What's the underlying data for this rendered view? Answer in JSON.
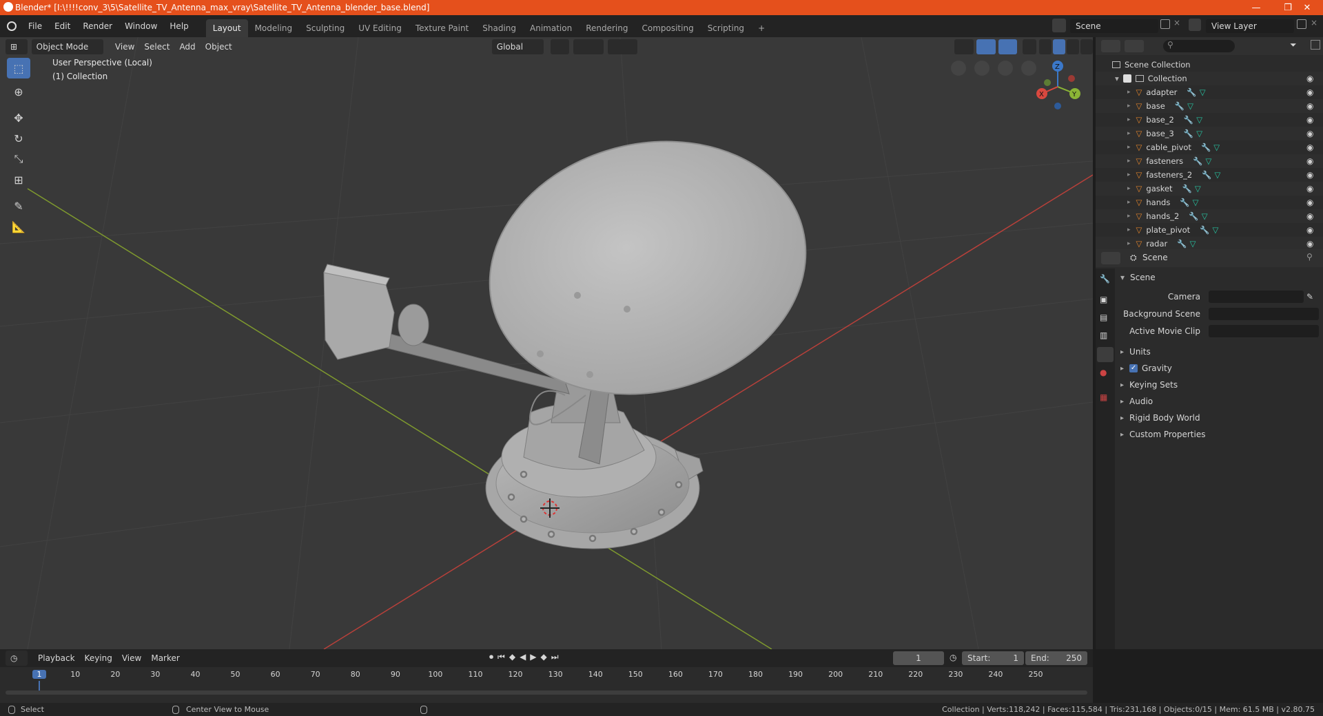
{
  "window": {
    "title": "Blender* [I:\\!!!!conv_3\\5\\Satellite_TV_Antenna_max_vray\\Satellite_TV_Antenna_blender_base.blend]",
    "minimize": "—",
    "maximize": "❐",
    "close": "✕"
  },
  "menu": [
    "File",
    "Edit",
    "Render",
    "Window",
    "Help"
  ],
  "workspaces": [
    "Layout",
    "Modeling",
    "Sculpting",
    "UV Editing",
    "Texture Paint",
    "Shading",
    "Animation",
    "Rendering",
    "Compositing",
    "Scripting"
  ],
  "workspace_add": "+",
  "scene_field": "Scene",
  "view_layer_field": "View Layer",
  "viewport": {
    "mode": "Object Mode",
    "menus": [
      "View",
      "Select",
      "Add",
      "Object"
    ],
    "orientation": "Global",
    "overlay_line1": "User Perspective (Local)",
    "overlay_line2": "(1) Collection",
    "gizmo": {
      "z": "Z",
      "y": "Y",
      "x": "X"
    }
  },
  "outliner": {
    "root": "Scene Collection",
    "collection": "Collection",
    "objects": [
      "adapter",
      "base",
      "base_2",
      "base_3",
      "cable_pivot",
      "fasteners",
      "fasteners_2",
      "gasket",
      "hands",
      "hands_2",
      "plate_pivot",
      "radar"
    ]
  },
  "properties": {
    "header": "Scene",
    "panel": "Scene",
    "fields": [
      {
        "label": "Camera"
      },
      {
        "label": "Background Scene"
      },
      {
        "label": "Active Movie Clip"
      }
    ],
    "subpanels": [
      "Units",
      "Gravity",
      "Keying Sets",
      "Audio",
      "Rigid Body World",
      "Custom Properties"
    ],
    "gravity_checked": true
  },
  "timeline": {
    "menus": [
      "Playback",
      "Keying",
      "View",
      "Marker"
    ],
    "current_frame": "1",
    "start_label": "Start:",
    "start": "1",
    "end_label": "End:",
    "end": "250",
    "ticks": [
      "1",
      "10",
      "20",
      "30",
      "40",
      "50",
      "60",
      "70",
      "80",
      "90",
      "100",
      "110",
      "120",
      "130",
      "140",
      "150",
      "160",
      "170",
      "180",
      "190",
      "200",
      "210",
      "220",
      "230",
      "240",
      "250"
    ]
  },
  "status": {
    "left_action": "Select",
    "middle_action": "Center View to Mouse",
    "stats": "Collection | Verts:118,242 | Faces:115,584 | Tris:231,168 | Objects:0/15 | Mem: 61.5 MB | v2.80.75"
  },
  "colors": {
    "titlebar": "#e5501c",
    "accent": "#4772b3",
    "x_axis": "#d9483f",
    "y_axis": "#8bb536",
    "z_axis": "#3b78c9",
    "object_icon": "#e0832b",
    "mesh_icon": "#27c4a2"
  }
}
